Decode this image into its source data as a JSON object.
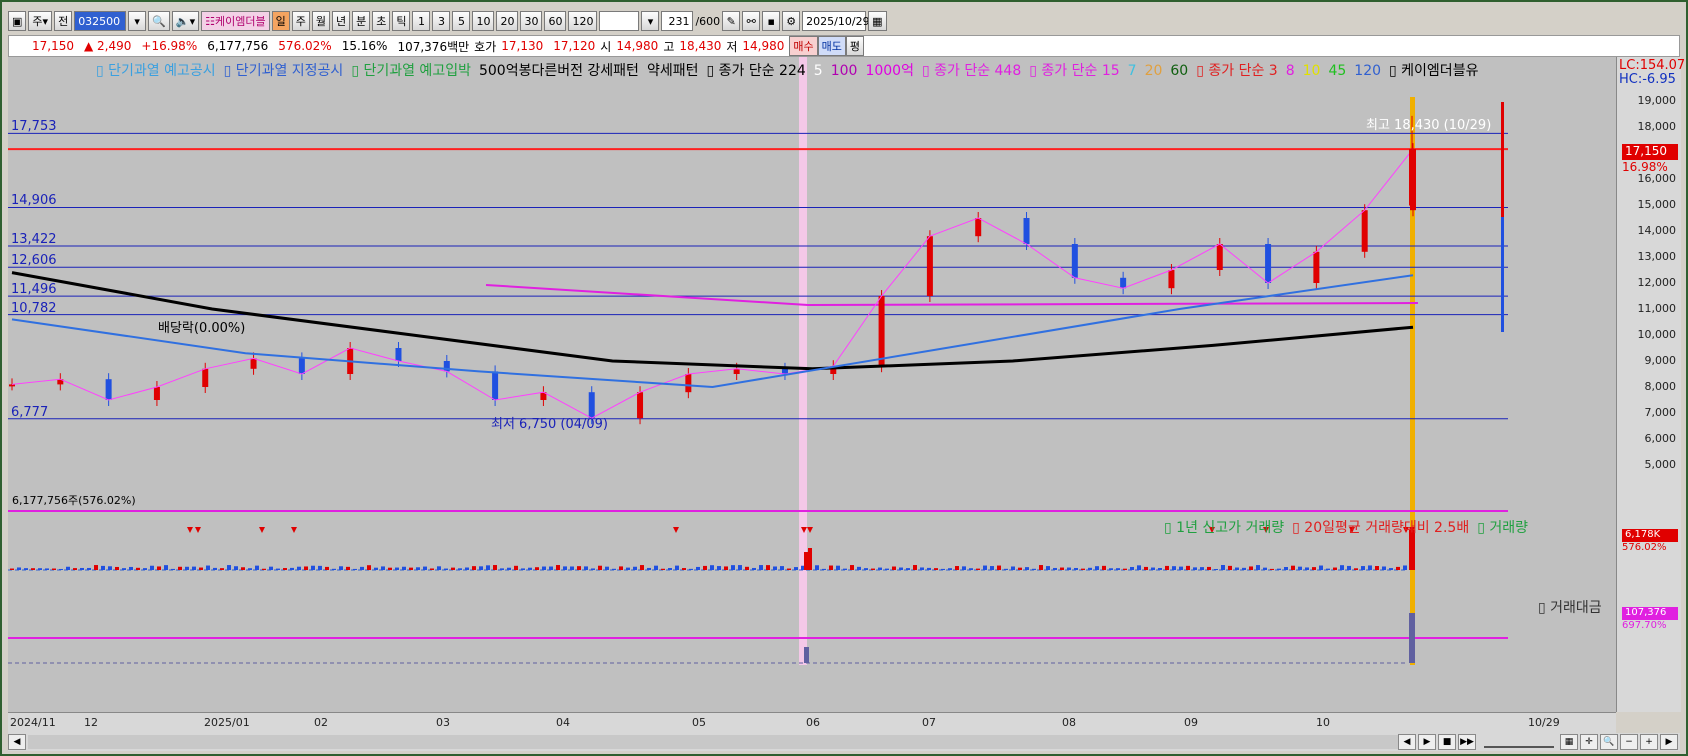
{
  "toolbar": {
    "type_sel": "주",
    "prev": "전",
    "code": "032500",
    "name": "케이엠더블",
    "period_tabs": [
      "일",
      "주",
      "월",
      "년"
    ],
    "interval_tabs": [
      "분",
      "초",
      "틱"
    ],
    "minute_opts": [
      "1",
      "3",
      "5",
      "10",
      "20",
      "30",
      "60",
      "120"
    ],
    "count": "231",
    "count_max": "/600",
    "date": "2025/10/29"
  },
  "quote": {
    "price": "17,150",
    "change": "▲ 2,490",
    "change_pct": "+16.98%",
    "volume": "6,177,756",
    "volume_pct": "576.02%",
    "turnover": "15.16%",
    "amount": "107,376백만",
    "ask_label": "호가",
    "ask": "17,130",
    "bid": "17,120",
    "open_label": "시",
    "open": "14,980",
    "high_label": "고",
    "high": "18,430",
    "low_label": "저",
    "low": "14,980",
    "buy": "매수",
    "sell": "매도",
    "eval": "평"
  },
  "legend": {
    "items": [
      {
        "text": "▯ 단기과열 예고공시",
        "color": "#3aa0e0"
      },
      {
        "text": "▯ 단기과열 지정공시",
        "color": "#3060d0"
      },
      {
        "text": "▯ 단기과열 예고입박",
        "color": "#20a040"
      },
      {
        "text": "500억봉다른버전 강세패턴",
        "color": "#000000"
      },
      {
        "text": "약세패턴",
        "color": "#000000"
      },
      {
        "text": "▯ 종가 단순 224",
        "color": "#000000"
      },
      {
        "text": "5",
        "color": "#ffffff"
      },
      {
        "text": "100",
        "color": "#b000b0"
      },
      {
        "text": "1000억",
        "color": "#e000e0"
      },
      {
        "text": "▯ 종가 단순 448",
        "color": "#e020e0"
      },
      {
        "text": "▯ 종가 단순 15",
        "color": "#e020e0"
      },
      {
        "text": "7",
        "color": "#40c0e0"
      },
      {
        "text": "20",
        "color": "#e0a040"
      },
      {
        "text": "60",
        "color": "#106010"
      },
      {
        "text": "▯ 종가 단순 3",
        "color": "#e02020"
      },
      {
        "text": "8",
        "color": "#e020e0"
      },
      {
        "text": "10",
        "color": "#e0e000"
      },
      {
        "text": "45",
        "color": "#20c020"
      },
      {
        "text": "120",
        "color": "#3060d0"
      },
      {
        "text": "▯ 케이엠더블유",
        "color": "#000000"
      }
    ],
    "lc": "LC:154.07",
    "hc": "HC:-6.95"
  },
  "levels": [
    {
      "label": "17,753",
      "value": 17753,
      "color": "#1a22b8"
    },
    {
      "label": "",
      "value": 17150,
      "color": "#ff2020"
    },
    {
      "label": "14,906",
      "value": 14906,
      "color": "#1a22b8"
    },
    {
      "label": "13,422",
      "value": 13422,
      "color": "#1a22b8"
    },
    {
      "label": "12,606",
      "value": 12606,
      "color": "#1a22b8"
    },
    {
      "label": "11,496",
      "value": 11496,
      "color": "#1a22b8"
    },
    {
      "label": "10,782",
      "value": 10782,
      "color": "#1a22b8"
    },
    {
      "label": "6,777",
      "value": 6777,
      "color": "#1a22b8"
    }
  ],
  "annotations": {
    "dividend": "배당락(0.00%)",
    "low": "최저 6,750 (04/09)",
    "high": "최고 18,430 (10/29)"
  },
  "price_axis": [
    "19,000",
    "18,000",
    "17,000",
    "16,000",
    "15,000",
    "14,000",
    "13,000",
    "12,000",
    "11,000",
    "10,000",
    "9,000",
    "8,000",
    "7,000",
    "6,000",
    "5,000"
  ],
  "price_badge": {
    "price": "17,150",
    "pct": "16.98%"
  },
  "volume": {
    "header": "6,177,756주(576.02%)",
    "legend": [
      {
        "text": "▯ 1년 신고가 거래량",
        "color": "#20a040"
      },
      {
        "text": "▯ 20일평균 거래량대비 2.5배",
        "color": "#e02020"
      },
      {
        "text": "▯ 거래량",
        "color": "#20a040"
      }
    ],
    "badge": "6,178K",
    "badge_pct": "576.02%"
  },
  "amount": {
    "legend": "▯ 거래대금",
    "badge": "107,376",
    "badge_pct": "697.70%"
  },
  "x_axis": [
    "2024/11",
    "12",
    "2025/01",
    "02",
    "03",
    "04",
    "05",
    "06",
    "07",
    "08",
    "09",
    "10",
    "10/29"
  ],
  "chart_data": {
    "type": "candlestick",
    "title": "케이엠더블유",
    "ylim": [
      5000,
      19500
    ],
    "x": [
      "2024/11",
      "12",
      "2025/01",
      "02",
      "03",
      "04",
      "05",
      "06",
      "07",
      "08",
      "09",
      "10",
      "10/29"
    ],
    "close_path": [
      8100,
      8300,
      7500,
      8000,
      8700,
      9100,
      8500,
      9500,
      9000,
      8600,
      7500,
      7800,
      6800,
      7800,
      8500,
      8700,
      8500,
      8800,
      11500,
      13800,
      14500,
      13500,
      12200,
      11800,
      12500,
      13500,
      12000,
      13200,
      14800,
      17150
    ],
    "ma224": [
      12400,
      11000,
      10000,
      9000,
      8700,
      9000,
      9600,
      10300
    ],
    "ma120": [
      10600,
      9300,
      8600,
      8000,
      9500,
      11000,
      12300
    ]
  }
}
